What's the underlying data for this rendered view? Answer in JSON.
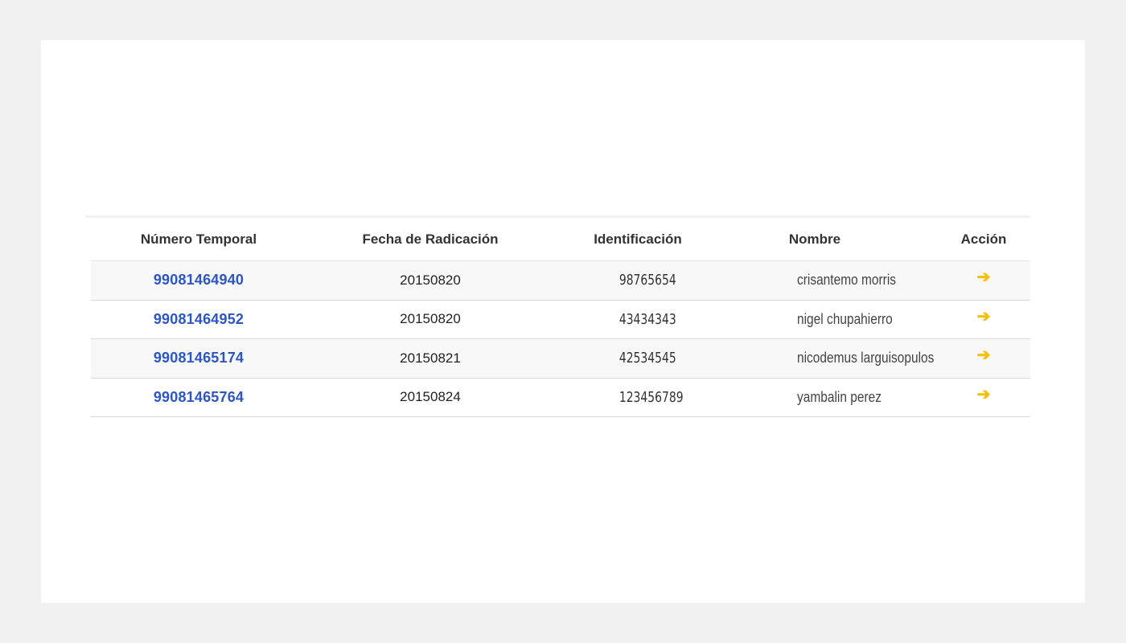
{
  "table": {
    "headers": {
      "numero": "Número Temporal",
      "fecha": "Fecha de Radicación",
      "identificacion": "Identificación",
      "nombre": "Nombre",
      "accion": "Acción"
    },
    "rows": [
      {
        "numero": "99081464940",
        "fecha": "20150820",
        "identificacion": "98765654",
        "nombre": "crisantemo morris"
      },
      {
        "numero": "99081464952",
        "fecha": "20150820",
        "identificacion": "43434343",
        "nombre": "nigel chupahierro"
      },
      {
        "numero": "99081465174",
        "fecha": "20150821",
        "identificacion": "42534545",
        "nombre": "nicodemus larguisopulos"
      },
      {
        "numero": "99081465764",
        "fecha": "20150824",
        "identificacion": "123456789",
        "nombre": "yambalin perez"
      }
    ],
    "action_icon": "arrow-right-icon",
    "colors": {
      "link": "#2a55cc",
      "action": "#f5c000",
      "alt_row": "#f8f8f8",
      "page_bg": "#f1f1f1"
    }
  }
}
